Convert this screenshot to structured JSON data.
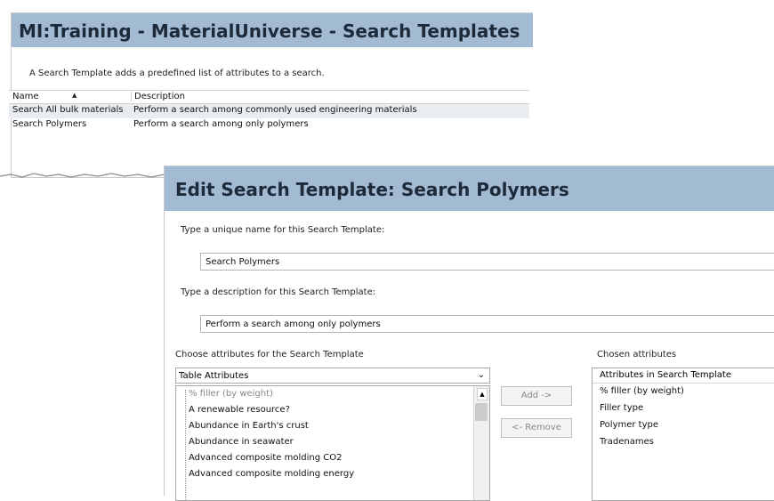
{
  "window1": {
    "title": "MI:Training - MaterialUniverse - Search Templates",
    "description": "A Search Template adds a predefined list of attributes to a search.",
    "columns": [
      "Name",
      "Description"
    ],
    "rows": [
      {
        "name": "Search All bulk materials",
        "description": "Perform a search among commonly used engineering materials"
      },
      {
        "name": "Search Polymers",
        "description": "Perform a search among only polymers"
      }
    ]
  },
  "window2": {
    "title": "Edit Search Template: Search Polymers",
    "name_label": "Type a unique name for this Search Template:",
    "name_value": "Search Polymers",
    "desc_label": "Type a description for this Search Template:",
    "desc_value": "Perform a search among only polymers",
    "choose_label": "Choose attributes for the Search Template",
    "chosen_label": "Chosen attributes",
    "dropdown_value": "Table Attributes",
    "available": [
      "% filler (by weight)",
      "A renewable resource?",
      "Abundance in Earth's crust",
      "Abundance in seawater",
      "Advanced composite molding CO2",
      "Advanced composite molding energy"
    ],
    "add_label": "Add ->",
    "remove_label": "<- Remove",
    "chosen_header": "Attributes in Search Template",
    "chosen": [
      "% filler (by weight)",
      "Filler type",
      "Polymer type",
      "Tradenames"
    ]
  },
  "colors": {
    "title_bar": "#a3bad3",
    "title_text": "#1d2a3a"
  }
}
